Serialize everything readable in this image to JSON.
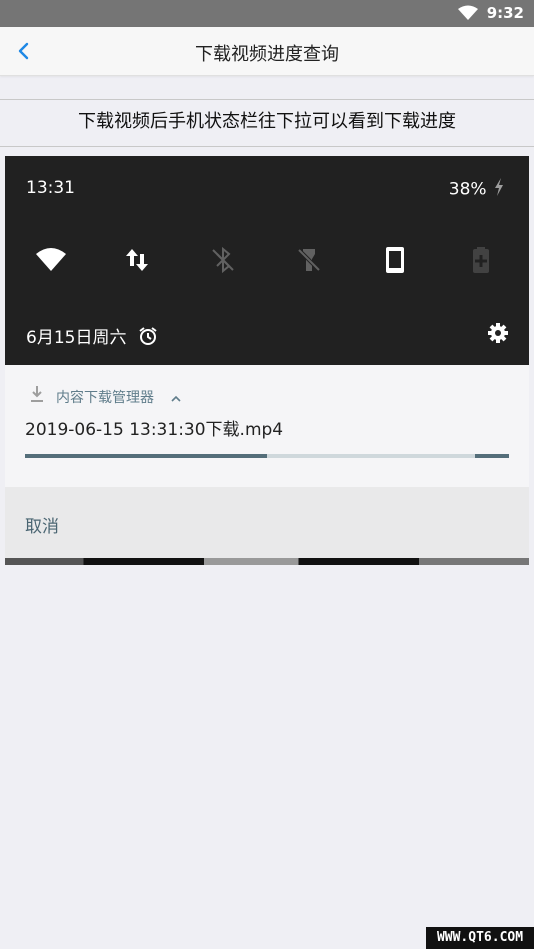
{
  "status_bar": {
    "time": "9:32",
    "wifi_icon": "wifi-icon"
  },
  "nav": {
    "title": "下载视频进度查询",
    "back_icon": "chevron-left-icon"
  },
  "hint": {
    "text": "下载视频后手机状态栏往下拉可以看到下载进度"
  },
  "shade": {
    "clock": "13:31",
    "battery": "38%",
    "date": "6月15日周六",
    "quick_settings": [
      "wifi-icon",
      "data-icon",
      "bluetooth-off-icon",
      "flashlight-off-icon",
      "rotation-icon",
      "battery-saver-icon"
    ]
  },
  "notification": {
    "app_name": "内容下载管理器",
    "filename": "2019-06-15 13:31:30下载.mp4",
    "progress": 0.5
  },
  "actions": {
    "cancel": "取消"
  },
  "watermark": {
    "text": "WWW.QT6.COM"
  },
  "colors": {
    "shade_bg": "#212121",
    "progress_fill": "#546e7a",
    "accent_blue": "#1e88e5"
  }
}
